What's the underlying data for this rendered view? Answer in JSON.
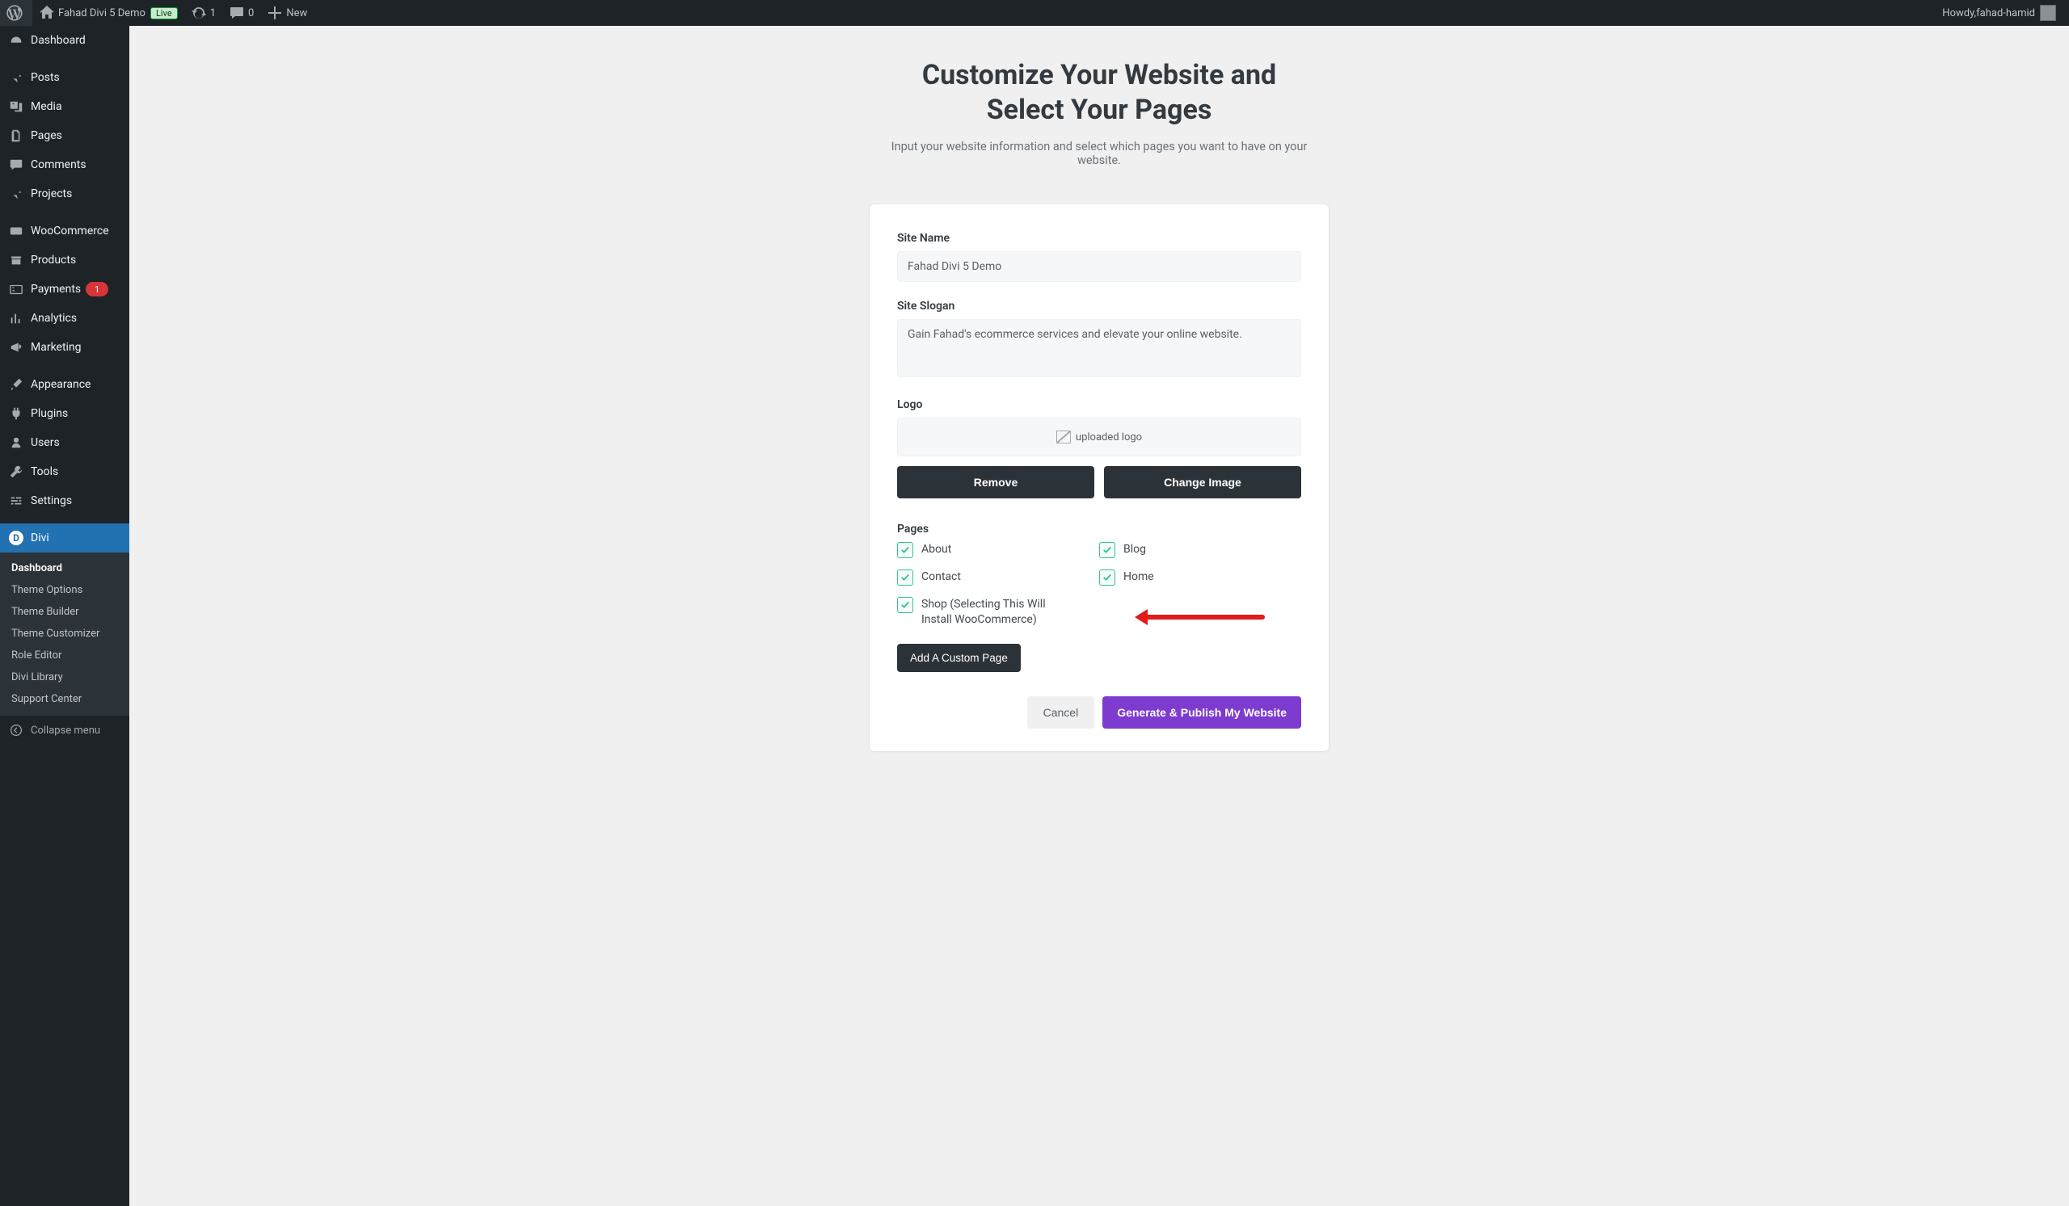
{
  "adminbar": {
    "site_name": "Fahad Divi 5 Demo",
    "live_label": "Live",
    "updates_count": "1",
    "comments_count": "0",
    "new_label": "New",
    "howdy_prefix": "Howdy, ",
    "user_name": "fahad-hamid"
  },
  "sidebar": {
    "items": [
      {
        "id": "dashboard",
        "label": "Dashboard",
        "icon": "dashboard-icon"
      },
      {
        "id": "sep1",
        "sep": true
      },
      {
        "id": "posts",
        "label": "Posts",
        "icon": "pin-icon"
      },
      {
        "id": "media",
        "label": "Media",
        "icon": "media-icon"
      },
      {
        "id": "pages",
        "label": "Pages",
        "icon": "pages-icon"
      },
      {
        "id": "comments",
        "label": "Comments",
        "icon": "comment-icon"
      },
      {
        "id": "projects",
        "label": "Projects",
        "icon": "pin-icon"
      },
      {
        "id": "sep2",
        "sep": true
      },
      {
        "id": "woocommerce",
        "label": "WooCommerce",
        "icon": "woo-icon"
      },
      {
        "id": "products",
        "label": "Products",
        "icon": "box-icon"
      },
      {
        "id": "payments",
        "label": "Payments",
        "icon": "card-icon",
        "badge": "1"
      },
      {
        "id": "analytics",
        "label": "Analytics",
        "icon": "chart-icon"
      },
      {
        "id": "marketing",
        "label": "Marketing",
        "icon": "megaphone-icon"
      },
      {
        "id": "sep3",
        "sep": true
      },
      {
        "id": "appearance",
        "label": "Appearance",
        "icon": "brush-icon"
      },
      {
        "id": "plugins",
        "label": "Plugins",
        "icon": "plug-icon"
      },
      {
        "id": "users",
        "label": "Users",
        "icon": "user-icon"
      },
      {
        "id": "tools",
        "label": "Tools",
        "icon": "wrench-icon"
      },
      {
        "id": "settings",
        "label": "Settings",
        "icon": "sliders-icon"
      },
      {
        "id": "sep4",
        "sep": true
      },
      {
        "id": "divi",
        "label": "Divi",
        "icon": "divi-icon",
        "current": true,
        "sub": [
          {
            "label": "Dashboard",
            "strong": true
          },
          {
            "label": "Theme Options"
          },
          {
            "label": "Theme Builder"
          },
          {
            "label": "Theme Customizer"
          },
          {
            "label": "Role Editor"
          },
          {
            "label": "Divi Library"
          },
          {
            "label": "Support Center"
          }
        ]
      }
    ],
    "collapse_label": "Collapse menu"
  },
  "wizard": {
    "title_line1": "Customize Your Website and",
    "title_line2": "Select Your Pages",
    "subtitle": "Input your website information and select which pages you want to have on your website.",
    "site_name_label": "Site Name",
    "site_name_value": "Fahad Divi 5 Demo",
    "site_slogan_label": "Site Slogan",
    "site_slogan_value": "Gain Fahad's ecommerce services and elevate your online website.",
    "logo_label": "Logo",
    "logo_alt": "uploaded logo",
    "remove_btn": "Remove",
    "change_img_btn": "Change Image",
    "pages_label": "Pages",
    "pages_left": [
      {
        "label": "About"
      },
      {
        "label": "Contact"
      },
      {
        "label": "Shop (Selecting This Will Install WooCommerce)"
      }
    ],
    "pages_right": [
      {
        "label": "Blog"
      },
      {
        "label": "Home"
      }
    ],
    "add_page_btn": "Add A Custom Page",
    "cancel_btn": "Cancel",
    "generate_btn": "Generate & Publish My Website"
  }
}
